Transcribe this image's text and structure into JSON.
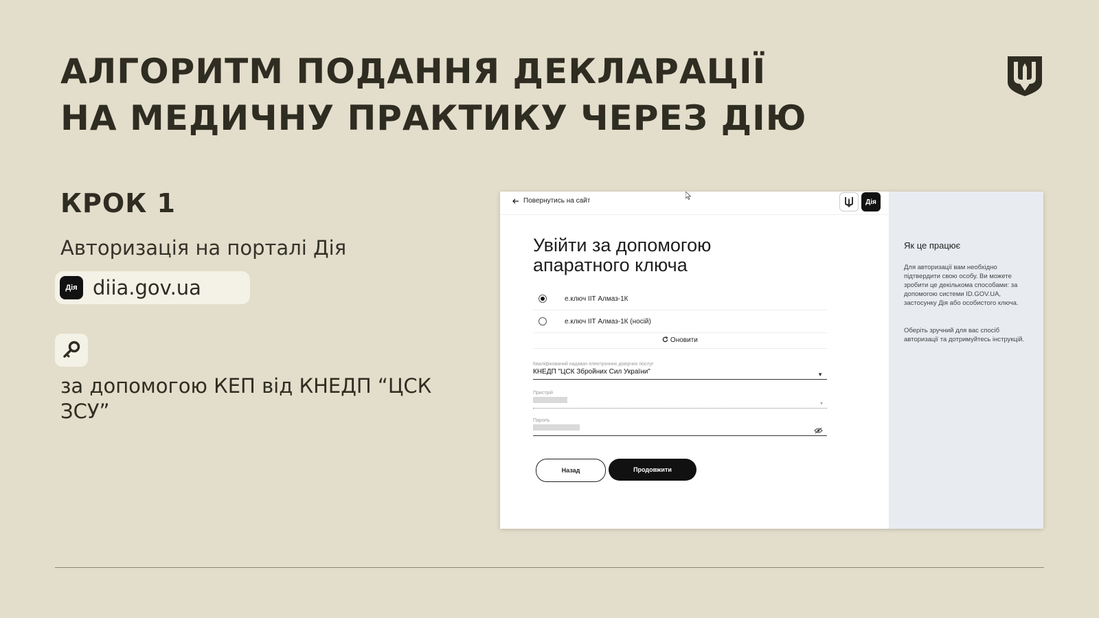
{
  "title": {
    "line1": "АЛГОРИТМ ПОДАННЯ ДЕКЛАРАЦІЇ",
    "line2": "НА МЕДИЧНУ ПРАКТИКУ ЧЕРЕЗ ДІЮ"
  },
  "step": {
    "title": "КРОК 1",
    "subtitle": "Авторизація на порталі Дія",
    "badge": "Дія",
    "url": "diia.gov.ua",
    "method": "за допомогою КЕП від КНЕДП “ЦСК ЗСУ”"
  },
  "screenshot": {
    "back_link": "Повернутись на сайт",
    "diia_badge": "Дія",
    "heading": "Увійти за допомогою апаратного ключа",
    "options": [
      {
        "label": "е.ключ ІІТ Алмаз-1К",
        "checked": true
      },
      {
        "label": "е.ключ ІІТ Алмаз-1К (носій)",
        "checked": false
      }
    ],
    "refresh_label": "Оновити",
    "provider_label": "Кваліфікований надавач електронних довірчих послуг",
    "provider_value": "КНЕДП \"ЦСК Збройних Сил України\"",
    "device_label": "Пристрій",
    "password_label": "Пароль",
    "back_button": "Назад",
    "continue_button": "Продовжити",
    "sidebar": {
      "title": "Як це працює",
      "p1": "Для авторизації вам необхідно підтвердити свою особу. Ви можете зробити це декількома способами: за допомогою системи ID.GOV.UA, застосунку Дія або особистого ключа.",
      "p2": "Оберіть зручний для вас спосіб авторизації та дотримуйтесь інструкцій."
    }
  },
  "colors": {
    "background": "#e3ddcb",
    "text": "#2f2d22",
    "pill": "#f4f1e7",
    "sidebar": "#e8ebf0"
  },
  "icons": [
    "trident-shield-icon",
    "key-icon",
    "arrow-left-icon",
    "refresh-icon",
    "eye-off-icon",
    "chevron-down-icon"
  ]
}
